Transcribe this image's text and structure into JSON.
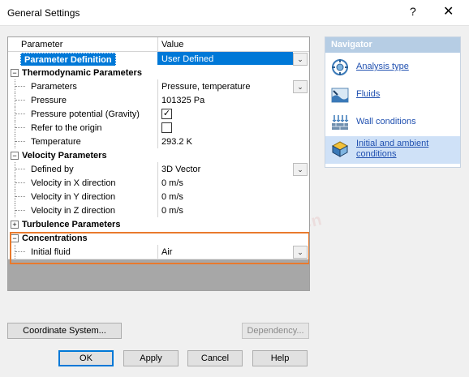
{
  "window": {
    "title": "General Settings",
    "help_glyph": "?",
    "close_glyph": "✕"
  },
  "grid": {
    "headers": {
      "parameter": "Parameter",
      "value": "Value"
    },
    "parameter_definition": {
      "label": "Parameter Definition",
      "value": "User Defined"
    },
    "thermo": {
      "title": "Thermodynamic Parameters",
      "expander": "−",
      "parameters": {
        "label": "Parameters",
        "value": "Pressure, temperature"
      },
      "pressure": {
        "label": "Pressure",
        "value": "101325 Pa"
      },
      "pressure_potential": {
        "label": "Pressure potential (Gravity)",
        "checked": true,
        "check_glyph": "✓"
      },
      "refer_origin": {
        "label": "Refer to the origin",
        "checked": false
      },
      "temperature": {
        "label": "Temperature",
        "value": "293.2 K"
      }
    },
    "velocity": {
      "title": "Velocity Parameters",
      "expander": "−",
      "defined_by": {
        "label": "Defined by",
        "value": "3D Vector"
      },
      "vx": {
        "label": "Velocity in X direction",
        "value": "0 m/s"
      },
      "vy": {
        "label": "Velocity in Y direction",
        "value": "0 m/s"
      },
      "vz": {
        "label": "Velocity in Z direction",
        "value": "0 m/s"
      }
    },
    "turbulence": {
      "title": "Turbulence Parameters",
      "expander": "+"
    },
    "concentrations": {
      "title": "Concentrations",
      "expander": "−",
      "initial_fluid": {
        "label": "Initial fluid",
        "value": "Air"
      }
    },
    "dropdown_glyph": "⌄"
  },
  "navigator": {
    "title": "Navigator",
    "items": [
      {
        "label": "Analysis type",
        "icon": "analysis-type-icon"
      },
      {
        "label": "Fluids",
        "icon": "fluids-icon"
      },
      {
        "label": "Wall conditions",
        "icon": "wall-conditions-icon"
      },
      {
        "label": "Initial and ambient conditions",
        "icon": "initial-conditions-icon",
        "active": true
      }
    ]
  },
  "buttons": {
    "coordinate_system": "Coordinate System...",
    "dependency": "Dependency...",
    "ok": "OK",
    "apply": "Apply",
    "cancel": "Cancel",
    "help": "Help"
  },
  "watermark": {
    "line1": "JOYSUN",
    "line2": "卓盛信息",
    "line3": "sw-joysun.com.cn"
  },
  "colors": {
    "selection": "#0078d7",
    "highlight_border": "#e97a2d",
    "navigator_header": "#b6cde4",
    "link": "#2050b0"
  }
}
